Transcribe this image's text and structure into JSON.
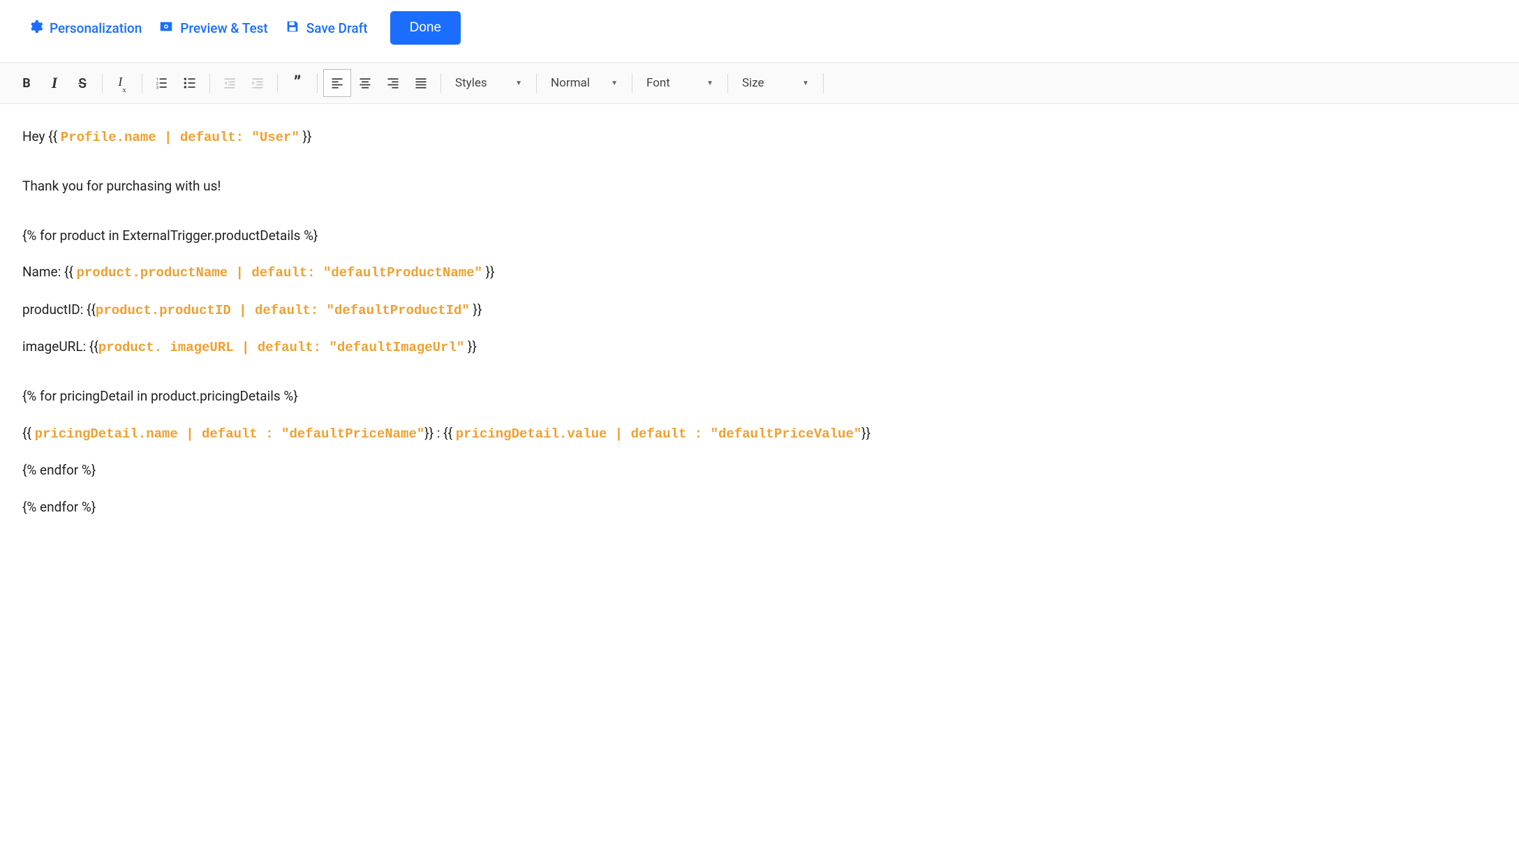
{
  "topbar": {
    "personalization": "Personalization",
    "preview_test": "Preview & Test",
    "save_draft": "Save Draft",
    "done": "Done"
  },
  "toolbar": {
    "styles_label": "Styles",
    "format_label": "Normal",
    "font_label": "Font",
    "size_label": "Size"
  },
  "editor": {
    "line1_pre": "Hey {{ ",
    "line1_token": "Profile.name | default: \"User\"",
    "line1_post": " }}",
    "line2": "Thank you for purchasing with us!",
    "line3": "{% for product in ExternalTrigger.productDetails %}",
    "line4_pre": "Name: {{ ",
    "line4_token": "product.productName | default: \"defaultProductName\"",
    "line4_post": " }}",
    "line5_pre": "productID: {{",
    "line5_token": "product.productID | default: \"defaultProductId\"",
    "line5_post": " }}",
    "line6_pre": "imageURL: {{",
    "line6_token": "product. imageURL | default: \"defaultImageUrl\"",
    "line6_post": " }}",
    "line7": "{% for pricingDetail in product.pricingDetails %}",
    "line8_pre": "{{ ",
    "line8_token1": "pricingDetail.name | default : \"defaultPriceName\"",
    "line8_mid": "}} : {{ ",
    "line8_token2": "pricingDetail.value | default : \"defaultPriceValue\"",
    "line8_post": "}}",
    "line9": " {% endfor %}",
    "line10": "{% endfor %}"
  }
}
